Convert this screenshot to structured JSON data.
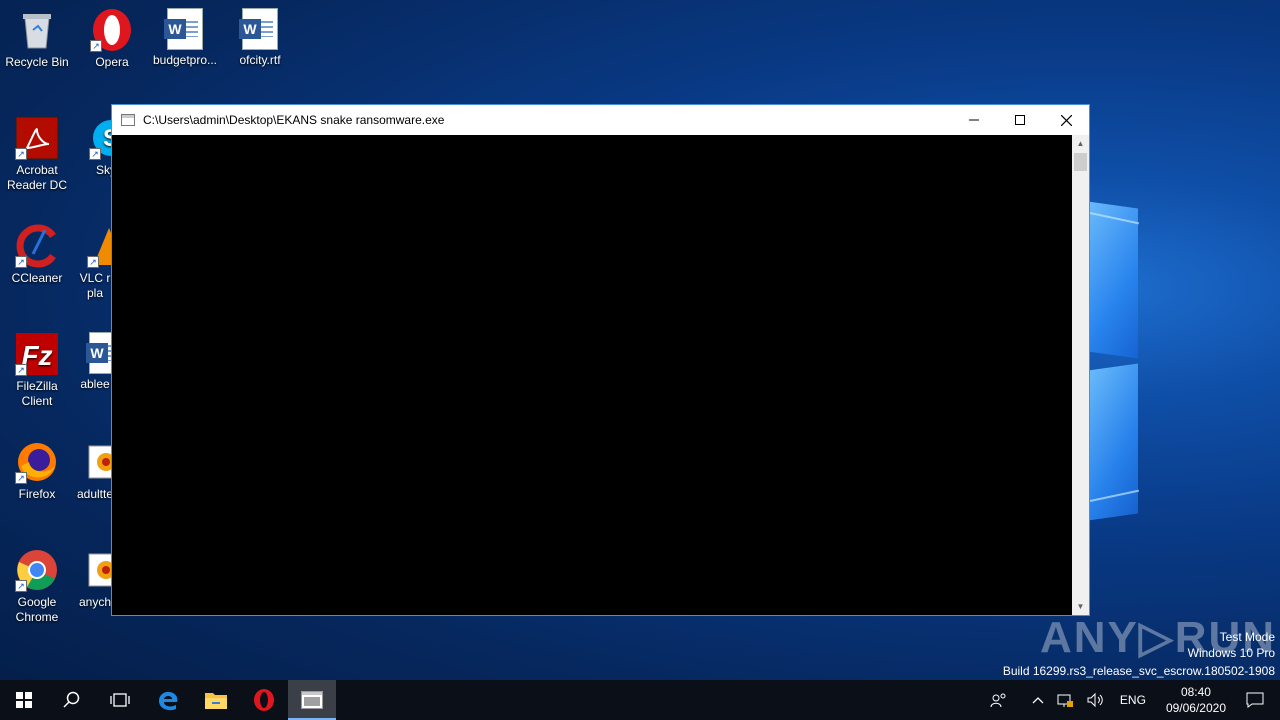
{
  "desktop": {
    "icons": [
      {
        "label": "Recycle Bin"
      },
      {
        "label": "Opera"
      },
      {
        "label": "budgetpro..."
      },
      {
        "label": "ofcity.rtf"
      },
      {
        "label": "Acrobat Reader DC"
      },
      {
        "label": "Sky"
      },
      {
        "label": "CCleaner"
      },
      {
        "label": "VLC r pla"
      },
      {
        "label": "FileZilla Client"
      },
      {
        "label": "ablee"
      },
      {
        "label": "Firefox"
      },
      {
        "label": "adultte"
      },
      {
        "label": "Google Chrome"
      },
      {
        "label": "anych"
      }
    ]
  },
  "window": {
    "title": "C:\\Users\\admin\\Desktop\\EKANS snake ransomware.exe",
    "minimize": "—",
    "maximize": "☐",
    "close": "✕"
  },
  "watermark": {
    "brand": "ANY▷RUN",
    "line1": "Test Mode",
    "line2": "Windows 10 Pro",
    "line3": "Build 16299.rs3_release_svc_escrow.180502-1908"
  },
  "taskbar": {
    "language": "ENG",
    "time": "08:40",
    "date": "09/06/2020"
  },
  "colors": {
    "taskbar_bg": "#0a0f18",
    "console_bg": "#000000",
    "window_border": "#4a90d9"
  }
}
